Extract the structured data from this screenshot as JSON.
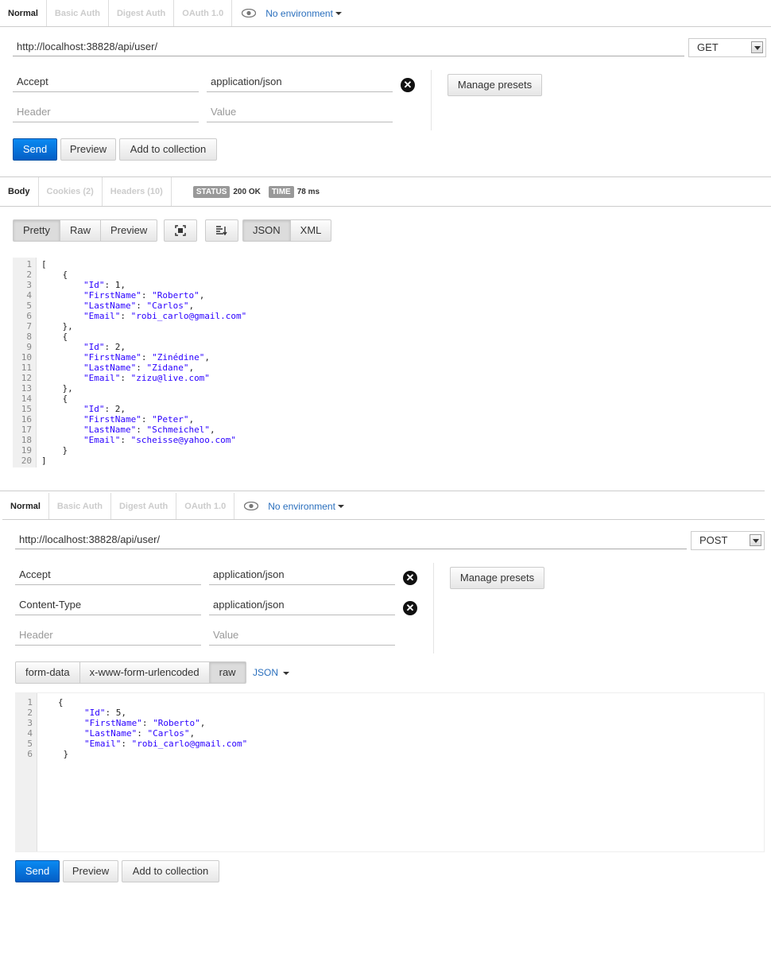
{
  "get_panel": {
    "auth_tabs": [
      "Normal",
      "Basic Auth",
      "Digest Auth",
      "OAuth 1.0"
    ],
    "environment": "No environment",
    "url": "http://localhost:38828/api/user/",
    "method": "GET",
    "headers": [
      {
        "key": "Accept",
        "value": "application/json"
      }
    ],
    "header_placeholder": "Header",
    "value_placeholder": "Value",
    "manage_presets": "Manage presets",
    "send": "Send",
    "preview": "Preview",
    "add_to_collection": "Add to collection"
  },
  "response": {
    "tabs": [
      "Body",
      "Cookies (2)",
      "Headers (10)"
    ],
    "status_label": "STATUS",
    "status_value": "200 OK",
    "time_label": "TIME",
    "time_value": "78 ms",
    "view_modes": [
      "Pretty",
      "Raw",
      "Preview"
    ],
    "formats": [
      "JSON",
      "XML"
    ],
    "line_numbers": [
      "1",
      "2",
      "3",
      "4",
      "5",
      "6",
      "7",
      "8",
      "9",
      "10",
      "11",
      "12",
      "13",
      "14",
      "15",
      "16",
      "17",
      "18",
      "19",
      "20"
    ],
    "body_lines": [
      "[",
      "    {",
      "        \"Id\": 1,",
      "        \"FirstName\": \"Roberto\",",
      "        \"LastName\": \"Carlos\",",
      "        \"Email\": \"robi_carlo@gmail.com\"",
      "    },",
      "    {",
      "        \"Id\": 2,",
      "        \"FirstName\": \"Zinédine\",",
      "        \"LastName\": \"Zidane\",",
      "        \"Email\": \"zizu@live.com\"",
      "    },",
      "    {",
      "        \"Id\": 2,",
      "        \"FirstName\": \"Peter\",",
      "        \"LastName\": \"Schmeichel\",",
      "        \"Email\": \"scheisse@yahoo.com\"",
      "    }",
      "]"
    ]
  },
  "post_panel": {
    "auth_tabs": [
      "Normal",
      "Basic Auth",
      "Digest Auth",
      "OAuth 1.0"
    ],
    "environment": "No environment",
    "url": "http://localhost:38828/api/user/",
    "method": "POST",
    "headers": [
      {
        "key": "Accept",
        "value": "application/json"
      },
      {
        "key": "Content-Type",
        "value": "application/json"
      }
    ],
    "header_placeholder": "Header",
    "value_placeholder": "Value",
    "manage_presets": "Manage presets",
    "body_modes": [
      "form-data",
      "x-www-form-urlencoded",
      "raw"
    ],
    "raw_format": "JSON",
    "line_numbers": [
      "1",
      "2",
      "3",
      "4",
      "5",
      "6"
    ],
    "body_lines": [
      "   {",
      "        \"Id\": 5,",
      "        \"FirstName\": \"Roberto\",",
      "        \"LastName\": \"Carlos\",",
      "        \"Email\": \"robi_carlo@gmail.com\"",
      "    }"
    ],
    "send": "Send",
    "preview": "Preview",
    "add_to_collection": "Add to collection"
  }
}
